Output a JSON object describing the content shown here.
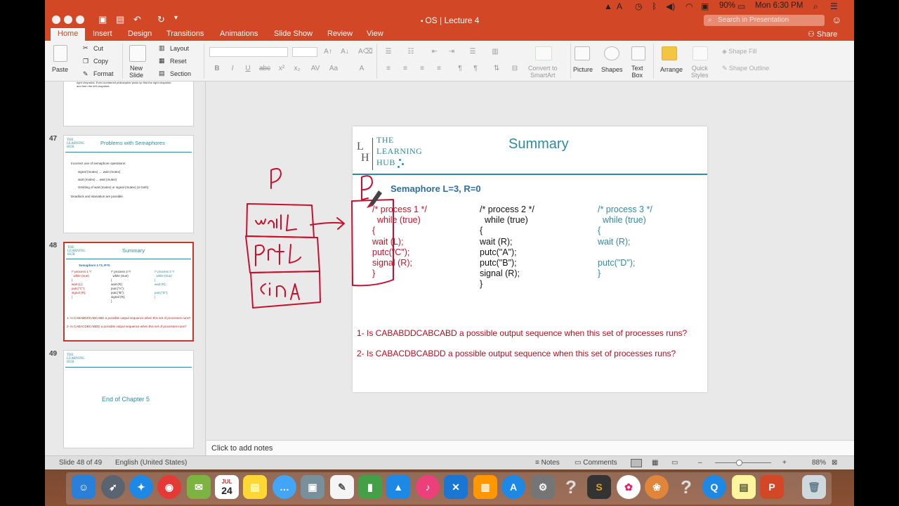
{
  "menubar": {
    "battery": "90%",
    "clock": "Mon 6:30 PM"
  },
  "window": {
    "title": "OS | Lecture 4",
    "search_placeholder": "Search in Presentation",
    "share_label": "Share"
  },
  "ribbon_tabs": [
    "Home",
    "Insert",
    "Design",
    "Transitions",
    "Animations",
    "Slide Show",
    "Review",
    "View"
  ],
  "ribbon": {
    "paste": "Paste",
    "cut": "Cut",
    "copy": "Copy",
    "format": "Format",
    "new_slide": "New\nSlide",
    "layout": "Layout",
    "reset": "Reset",
    "section": "Section",
    "convert": "Convert to\nSmartArt",
    "picture": "Picture",
    "shapes": "Shapes",
    "text_box": "Text\nBox",
    "arrange": "Arrange",
    "quick_styles": "Quick\nStyles",
    "shape_fill": "Shape Fill",
    "shape_outline": "Shape Outline"
  },
  "thumbnails": {
    "prev_text": "right chopstick. Even numbered  philosopher picks  up first the right chopstick and then the left chopstick.",
    "s47": {
      "num": "47",
      "title": "Problems with Semaphores",
      "bullets": [
        "Incorrect use of semaphore operations:",
        "signal (mutex)  ....  wait (mutex)",
        "wait (mutex)  ...  wait (mutex)",
        "Omitting  of wait (mutex) or signal (mutex) (or both)",
        "Deadlock and starvation are possible."
      ]
    },
    "s48": {
      "num": "48",
      "title": "Summary",
      "sub": "Semaphore L=3, R=0",
      "q1": "1- Is CABABDDCABCABD a possible output sequence when this set of processes runs?",
      "q2": "2- Is CABACDBCABDD a possible output sequence when this set of processes runs?"
    },
    "s49": {
      "num": "49",
      "title": "End of Chapter 5"
    }
  },
  "slide": {
    "logo_line1": "THE",
    "logo_line2": "LEARNING",
    "logo_line3": "HUB",
    "title": "Summary",
    "semaphore": "Semaphore L=3, R=0",
    "p1": "/* process 1 */\n  while (true)\n{\nwait (L);\nputc(\"C\");\nsignal (R);\n}",
    "p2": "/* process 2 */\n  while (true)\n{\nwait (R);\nputc(\"A\");\nputc(\"B\");\nsignal (R);\n}",
    "p3": "/* process 3 */\n  while (true)\n{\nwait (R);\n\nputc(\"D\");\n}",
    "q1": "1- Is CABABDDCABCABD a possible output sequence when this set of processes runs?",
    "q2": "2- Is CABACDBCABDD a possible output sequence when this set of processes runs?"
  },
  "notes_placeholder": "Click to add notes",
  "status": {
    "slide": "Slide 48 of 49",
    "language": "English (United States)",
    "notes": "Notes",
    "comments": "Comments",
    "zoom": "88%"
  },
  "dock": {
    "calendar_month": "JUL",
    "calendar_day": "24"
  },
  "colors": {
    "accent": "#d24726",
    "teal": "#2e8ba0",
    "ink": "#c0152b"
  }
}
